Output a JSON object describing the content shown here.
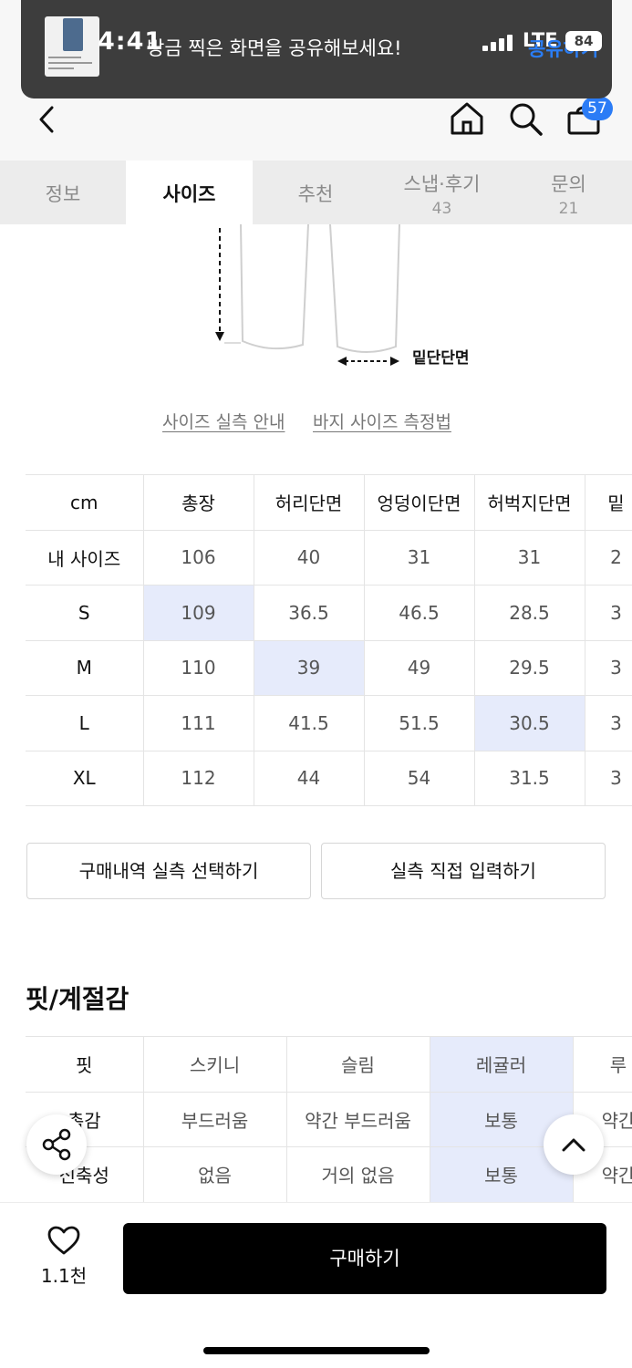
{
  "status_bar": {
    "time": "4:41",
    "network": "LTE",
    "battery": "84"
  },
  "toast": {
    "message": "방금 찍은 화면을 공유해보세요!",
    "action": "공유하기"
  },
  "header": {
    "cart_count": "57"
  },
  "tabs": [
    {
      "label": "정보",
      "count": ""
    },
    {
      "label": "사이즈",
      "count": ""
    },
    {
      "label": "추천",
      "count": ""
    },
    {
      "label": "스냅·후기",
      "count": "43"
    },
    {
      "label": "문의",
      "count": "21"
    }
  ],
  "diagram": {
    "hem_label": "밑단단면"
  },
  "guide_links": {
    "size_guide": "사이즈 실측 안내",
    "measure_guide": "바지 사이즈 측정법"
  },
  "size_table": {
    "headers": [
      "cm",
      "총장",
      "허리단면",
      "엉덩이단면",
      "허벅지단면",
      "밑"
    ],
    "rows": [
      {
        "label": "내 사이즈",
        "values": [
          "106",
          "40",
          "31",
          "31",
          "2"
        ]
      },
      {
        "label": "S",
        "values": [
          "109",
          "36.5",
          "46.5",
          "28.5",
          "3"
        ]
      },
      {
        "label": "M",
        "values": [
          "110",
          "39",
          "49",
          "29.5",
          "3"
        ]
      },
      {
        "label": "L",
        "values": [
          "111",
          "41.5",
          "51.5",
          "30.5",
          "3"
        ]
      },
      {
        "label": "XL",
        "values": [
          "112",
          "44",
          "54",
          "31.5",
          "3"
        ]
      }
    ]
  },
  "actions": {
    "purchase_history": "구매내역 실측 선택하기",
    "manual_input": "실측 직접 입력하기"
  },
  "fit_section": {
    "title": "핏/계절감",
    "rows": [
      {
        "label": "핏",
        "values": [
          "스키니",
          "슬림",
          "레귤러",
          "루"
        ]
      },
      {
        "label": "촉감",
        "values": [
          "부드러움",
          "약간 부드러움",
          "보통",
          "약간"
        ]
      },
      {
        "label": "신축성",
        "values": [
          "없음",
          "거의 없음",
          "보통",
          "약간"
        ]
      }
    ]
  },
  "bottom_bar": {
    "like_count": "1.1천",
    "buy_label": "구매하기"
  }
}
